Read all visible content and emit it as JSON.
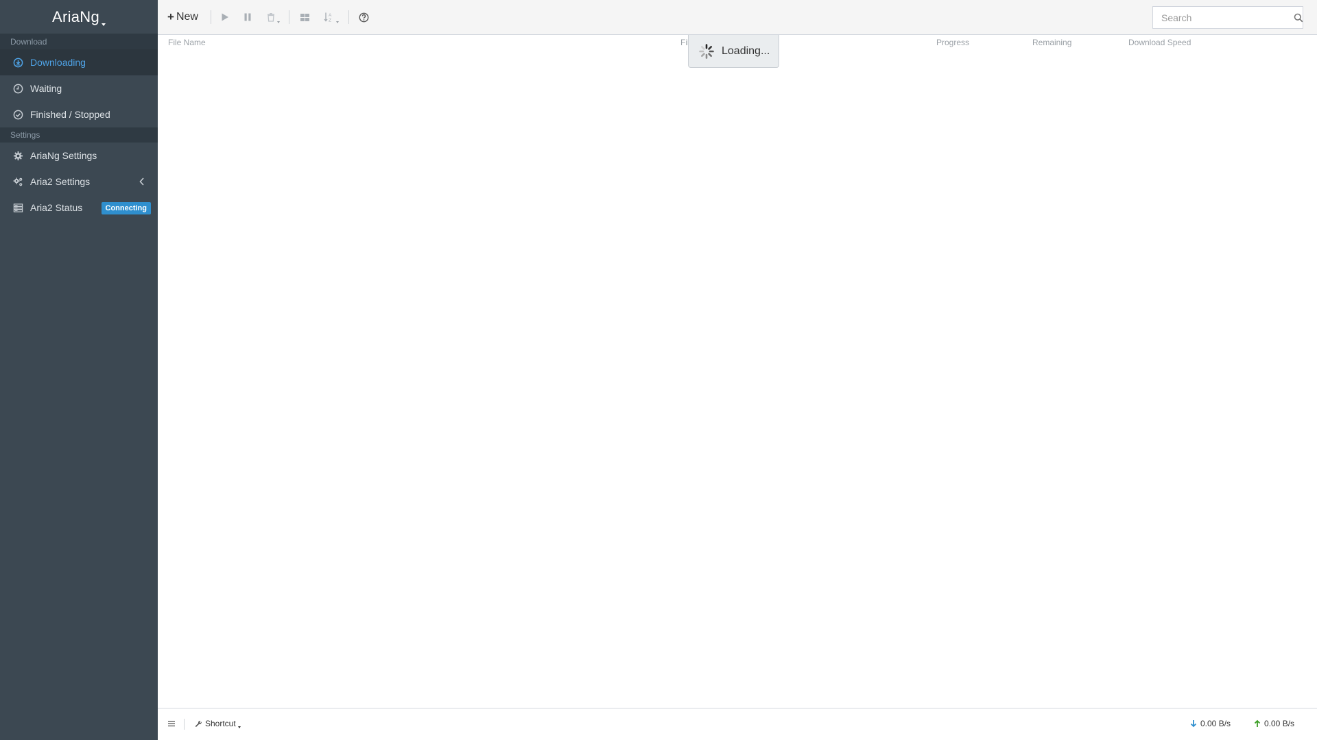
{
  "app": {
    "logo": "AriaNg"
  },
  "sidebar": {
    "sections": [
      {
        "header": "Download",
        "items": [
          {
            "label": "Downloading",
            "icon": "download-circle-icon",
            "active": true
          },
          {
            "label": "Waiting",
            "icon": "clock-icon"
          },
          {
            "label": "Finished / Stopped",
            "icon": "check-circle-icon"
          }
        ]
      },
      {
        "header": "Settings",
        "items": [
          {
            "label": "AriaNg Settings",
            "icon": "gear-icon"
          },
          {
            "label": "Aria2 Settings",
            "icon": "gears-icon"
          },
          {
            "label": "Aria2 Status",
            "icon": "server-icon",
            "badge": "Connecting"
          }
        ]
      }
    ]
  },
  "toolbar": {
    "new_label": "New",
    "search_placeholder": "Search"
  },
  "table": {
    "columns": [
      "File Name",
      "Fil",
      "Progress",
      "Remaining",
      "Download Speed"
    ]
  },
  "loading": {
    "text": "Loading..."
  },
  "footer": {
    "shortcut_label": "Shortcut",
    "download_speed": "0.00 B/s",
    "upload_speed": "0.00 B/s"
  },
  "colors": {
    "sidebar_bg": "#3c4852",
    "sidebar_active_bg": "#2c363e",
    "accent": "#4fa4e8",
    "badge": "#2f8fce",
    "download_arrow": "#2f8fce",
    "upload_arrow": "#3a9d23"
  }
}
